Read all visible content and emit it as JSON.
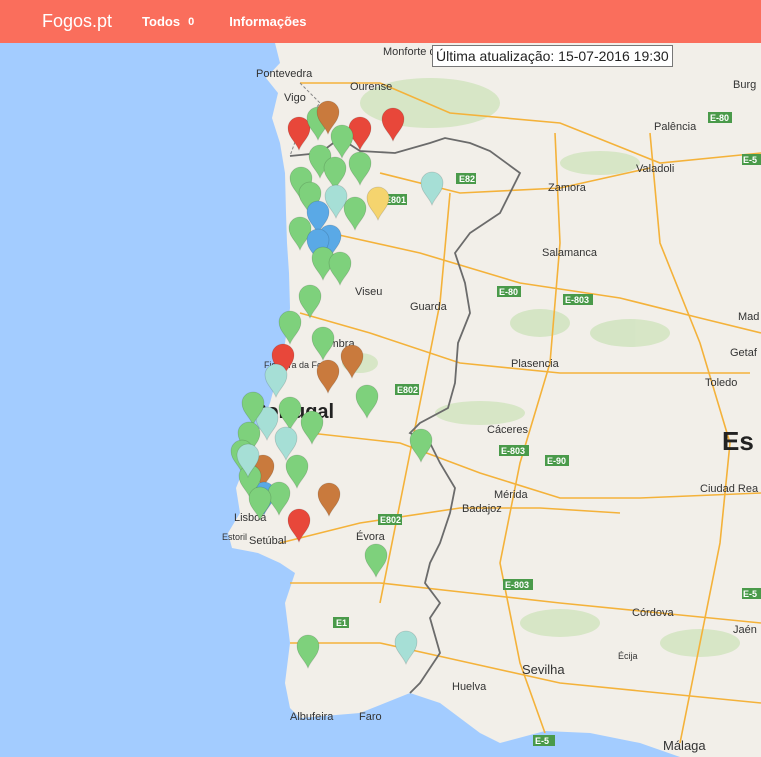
{
  "navbar": {
    "brand": "Fogos.pt",
    "todos_label": "Todos",
    "todos_count": "0",
    "info_label": "Informações"
  },
  "update": {
    "text": "Última atualização: 15-07-2016 19:30"
  },
  "colors": {
    "navbar": "#fa6e5c",
    "ocean": "#a3ccff",
    "land": "#f2efe9",
    "marker_green": "#7ed17c",
    "marker_red": "#e8473a",
    "marker_brown": "#c97a3d",
    "marker_blue": "#5aa9e6",
    "marker_lightcyan": "#a6dfd6",
    "marker_yellow": "#f5d46e"
  },
  "map_labels": {
    "big": [
      "Portugal",
      "Es"
    ],
    "cities": [
      "Monforte de Lemos",
      "Pontevedra",
      "Vigo",
      "Ourense",
      "Burg",
      "Palência",
      "Valadoli",
      "Zamora",
      "Salamanca",
      "Viseu",
      "Guarda",
      "Coimbra",
      "Figueira da Foz",
      "Plasencia",
      "Mad",
      "Getaf",
      "Toledo",
      "Cáceres",
      "Mérida",
      "Badajoz",
      "Ciudad Rea",
      "Lisboa",
      "Estoril",
      "Setúbal",
      "Évora",
      "Córdova",
      "Jaén",
      "Écija",
      "Sevilha",
      "Huelva",
      "Albufeira",
      "Faro",
      "Málaga"
    ],
    "roads": [
      "E801",
      "E82",
      "E-80",
      "E-803",
      "E802",
      "E-803",
      "E-90",
      "E802",
      "E-803",
      "E1",
      "E-5",
      "E-80",
      "E-5",
      "E-5"
    ]
  },
  "markers": [
    {
      "color": "red"
    },
    {
      "color": "green"
    },
    {
      "color": "brown"
    },
    {
      "color": "red"
    },
    {
      "color": "red"
    },
    {
      "color": "green"
    },
    {
      "color": "green"
    },
    {
      "color": "green"
    },
    {
      "color": "green"
    },
    {
      "color": "lightcyan"
    },
    {
      "color": "yellow"
    },
    {
      "color": "green"
    },
    {
      "color": "green"
    },
    {
      "color": "blue"
    },
    {
      "color": "blue"
    },
    {
      "color": "green"
    },
    {
      "color": "lightcyan"
    },
    {
      "color": "green"
    },
    {
      "color": "blue"
    },
    {
      "color": "green"
    },
    {
      "color": "green"
    },
    {
      "color": "red"
    },
    {
      "color": "brown"
    },
    {
      "color": "brown"
    },
    {
      "color": "green"
    },
    {
      "color": "lightcyan"
    },
    {
      "color": "green"
    },
    {
      "color": "green"
    },
    {
      "color": "green"
    },
    {
      "color": "lightcyan"
    },
    {
      "color": "green"
    },
    {
      "color": "green"
    },
    {
      "color": "lightcyan"
    },
    {
      "color": "green"
    },
    {
      "color": "green"
    },
    {
      "color": "brown"
    },
    {
      "color": "green"
    },
    {
      "color": "blue"
    },
    {
      "color": "green"
    },
    {
      "color": "brown"
    },
    {
      "color": "red"
    },
    {
      "color": "green"
    },
    {
      "color": "green"
    },
    {
      "color": "lightcyan"
    },
    {
      "color": "green"
    },
    {
      "color": "green"
    },
    {
      "color": "green"
    },
    {
      "color": "lightcyan"
    },
    {
      "color": "green"
    }
  ]
}
